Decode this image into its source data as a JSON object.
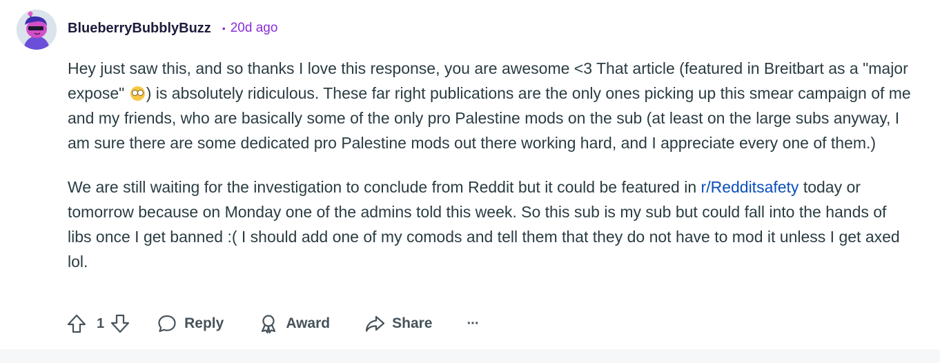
{
  "comment": {
    "username": "BlueberryBubblyBuzz",
    "separator": "•",
    "timestamp": "20d ago",
    "paragraph1_part1": "Hey just saw this, and so thanks I love this response, you are awesome <3 That article (featured in Breitbart as a \"major expose\" ",
    "paragraph1_emoji": "flushed-face-emoji",
    "paragraph1_part2": ") is absolutely ridiculous. These far right publications are the only ones picking up this smear campaign of me and my friends, who are basically some of the only pro Palestine mods on the sub (at least on the large subs anyway, I am sure there are some dedicated pro Palestine mods out there working hard, and I appreciate every one of them.)",
    "paragraph2_part1": "We are still waiting for the investigation to conclude from Reddit but it could be featured in ",
    "paragraph2_link": "r/Redditsafety",
    "paragraph2_part2": " today or tomorrow because on Monday one of the admins told this week. So this sub is my sub but could fall into the hands of libs once I get banned :( I should add one of my comods and tell them that they do not have to mod it unless I get axed lol."
  },
  "actions": {
    "score": "1",
    "reply_label": "Reply",
    "award_label": "Award",
    "share_label": "Share",
    "more_label": "···"
  },
  "colors": {
    "timestamp": "#8b2bd6",
    "link": "#0a4fb8",
    "action_text": "#46525a",
    "body_text": "#2a3c42"
  },
  "icons": [
    "upvote-icon",
    "downvote-icon",
    "reply-bubble-icon",
    "award-icon",
    "share-icon",
    "more-icon"
  ]
}
